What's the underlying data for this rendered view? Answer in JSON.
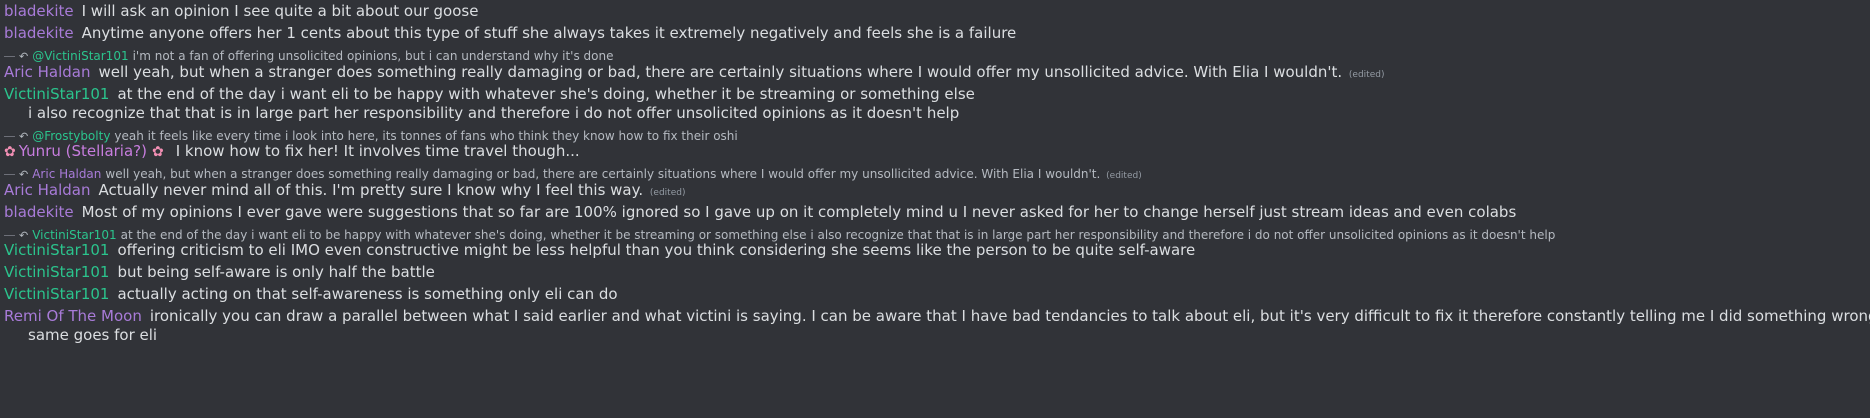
{
  "messages": [
    {
      "type": "msg",
      "user": "bladekite",
      "color": "#a87bd8",
      "text": "I will ask an opinion I see quite a bit about our goose"
    },
    {
      "type": "msg",
      "user": "bladekite",
      "color": "#a87bd8",
      "text": "Anytime anyone offers her 1 cents about this type of stuff she always takes it extremely negatively and feels she is a failure"
    },
    {
      "type": "reply",
      "reply_to": "@VictiniStar101",
      "reply_color": "#2bc48d",
      "text": "i'm not a fan of offering unsolicited opinions, but i can understand why it's done"
    },
    {
      "type": "msg",
      "user": "Aric Haldan",
      "color": "#a87bd8",
      "text": "well yeah, but when a stranger does something really damaging or bad, there are certainly situations where I would offer my unsollicited advice. With Elia I wouldn't.",
      "edited": "(edited)"
    },
    {
      "type": "msg",
      "user": "VictiniStar101",
      "color": "#2bc48d",
      "text": "at the end of the day i want eli to be happy with whatever she's doing, whether it be streaming or something else"
    },
    {
      "type": "cont",
      "text": "i also recognize that that is in large part her responsibility and therefore i do not offer unsolicited opinions as it doesn't help"
    },
    {
      "type": "reply",
      "reply_to": "@Frostybolty",
      "reply_color": "#2bc48d",
      "text": "yeah it feels like every time i look into here, its tonnes of fans who think they know how to fix their oshi"
    },
    {
      "type": "msg",
      "user": "Yunru (Stellaria?)",
      "color": "#c77dde",
      "flowers": true,
      "text": "I know how to fix her! It involves time travel though..."
    },
    {
      "type": "reply",
      "reply_to": "Aric Haldan",
      "reply_color": "#a87bd8",
      "text": "well yeah, but when a stranger does something really damaging or bad, there are certainly situations where I would offer my unsollicited advice. With Elia I wouldn't.",
      "edited": "(edited)"
    },
    {
      "type": "msg",
      "user": "Aric Haldan",
      "color": "#a87bd8",
      "text": "Actually never mind all of this. I'm pretty sure I know why I feel this way.",
      "edited": "(edited)"
    },
    {
      "type": "msg",
      "user": "bladekite",
      "color": "#a87bd8",
      "text": "Most of my opinions I ever gave were suggestions that so far are 100% ignored so I gave up on it completely mind u I never asked for her to change herself just stream ideas and even colabs"
    },
    {
      "type": "reply",
      "reply_to": "VictiniStar101",
      "reply_color": "#2bc48d",
      "text": "at the end of the day i want eli to be happy with whatever she's doing, whether it be streaming or something else i also recognize that that is in large part her responsibility and therefore i do not offer unsolicited opinions as it doesn't help"
    },
    {
      "type": "msg",
      "user": "VictiniStar101",
      "color": "#2bc48d",
      "text": "offering criticism to eli IMO even constructive might be less helpful than you think considering she seems like the person to be quite self-aware"
    },
    {
      "type": "msg",
      "user": "VictiniStar101",
      "color": "#2bc48d",
      "text": "but being self-aware is only half the battle"
    },
    {
      "type": "msg",
      "user": "VictiniStar101",
      "color": "#2bc48d",
      "text": "actually acting on that self-awareness is something only eli can do"
    },
    {
      "type": "msg",
      "user": "Remi Of The Moon",
      "color": "#a87bd8",
      "text": "ironically you can draw a parallel between what I said earlier and what victini is saying. I can be aware that I have bad tendancies to talk about eli, but it's very difficult to fix it therefore constantly telling me I did something wrong will only make me feel bad."
    },
    {
      "type": "cont",
      "text": "same goes for eli"
    }
  ],
  "icons": {
    "reply": "reply-arrow-icon",
    "flower": "cherry-blossom-icon"
  }
}
